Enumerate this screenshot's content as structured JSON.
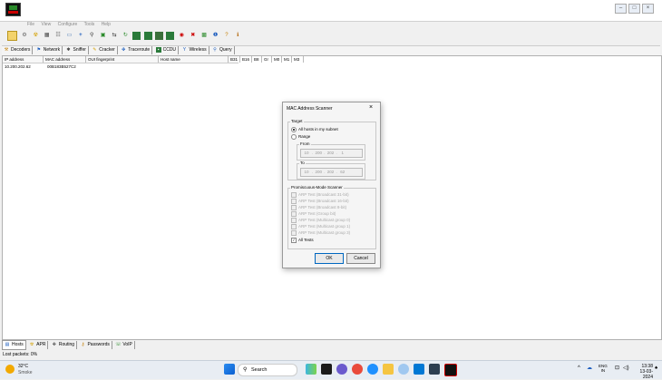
{
  "menu": [
    "File",
    "View",
    "Configure",
    "Tools",
    "Help"
  ],
  "toolbar_icons": [
    "open-icon",
    "gear-icon",
    "radiation-icon",
    "grid-icon",
    "network-icon",
    "monitor-icon",
    "add-icon",
    "filter-icon",
    "cert-icon",
    "route-icon",
    "refresh-icon",
    "grid2-icon",
    "grid3-icon",
    "grid4-icon",
    "grid5-icon",
    "wifi-icon",
    "x-icon",
    "info-icon",
    "question-icon",
    "person-icon"
  ],
  "tabs": [
    {
      "label": "Decoders",
      "icon": "decoder-icon"
    },
    {
      "label": "Network",
      "icon": "network-icon"
    },
    {
      "label": "Sniffer",
      "icon": "sniffer-icon"
    },
    {
      "label": "Cracker",
      "icon": "cracker-icon"
    },
    {
      "label": "Traceroute",
      "icon": "traceroute-icon"
    },
    {
      "label": "CCDU",
      "icon": "ccdu-icon"
    },
    {
      "label": "Wireless",
      "icon": "wireless-icon"
    },
    {
      "label": "Query",
      "icon": "query-icon"
    }
  ],
  "columns": [
    "IP address",
    "MAC address",
    "OUI fingerprint",
    "Host name",
    "B31",
    "B16",
    "B8",
    "Gr",
    "M0",
    "M1",
    "M3"
  ],
  "rows": [
    {
      "ip": "10.200.202.62",
      "mac": "00B183B527C2"
    }
  ],
  "dialog": {
    "title": "MAC Address Scanner",
    "target_label": "Target",
    "opt_all": "All hosts in my subnet",
    "opt_range": "Range",
    "from_label": "From",
    "from_ip": [
      "10",
      "200",
      "202",
      "1"
    ],
    "to_label": "To",
    "to_ip": [
      "10",
      "200",
      "202",
      "62"
    ],
    "promisc_label": "Promiscuous-Mode Scanner",
    "tests": [
      "ARP Test (Broadcast 31-bit)",
      "ARP Test (Broadcast 16-bit)",
      "ARP Test (Broadcast 8-bit)",
      "ARP Test (Group bit)",
      "ARP Test (Multicast group 0)",
      "ARP Test (Multicast group 1)",
      "ARP Test (Multicast group 3)"
    ],
    "all_tests": "All Tests",
    "ok": "OK",
    "cancel": "Cancel"
  },
  "bottom_tabs": [
    {
      "label": "Hosts",
      "icon": "hosts-icon"
    },
    {
      "label": "APR",
      "icon": "apr-icon"
    },
    {
      "label": "Routing",
      "icon": "routing-icon"
    },
    {
      "label": "Passwords",
      "icon": "passwords-icon"
    },
    {
      "label": "VoIP",
      "icon": "voip-icon"
    }
  ],
  "status": "Lost packets:  0%",
  "taskbar": {
    "weather_temp": "32°C",
    "weather_desc": "Smoke",
    "search": "Search",
    "lang1": "ENG",
    "lang2": "IN",
    "time": "13:38",
    "date": "13-03-2024"
  },
  "colors": {
    "accent": "#0067c0",
    "taskbar": "#e8edf3"
  }
}
